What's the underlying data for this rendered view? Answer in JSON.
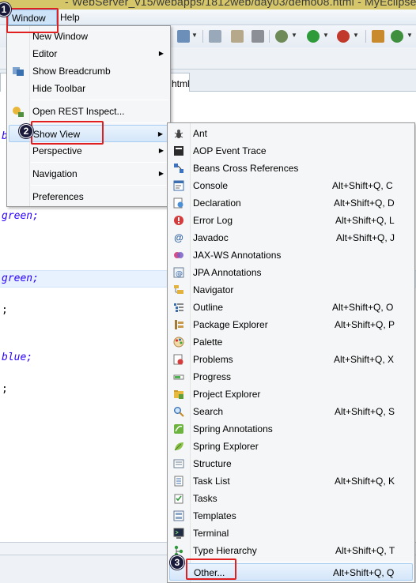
{
  "title_bar": {
    "text": "- WebServer_v15/webapps/1812web/day03/demo08.html - MyEclipse"
  },
  "menubar": {
    "window_label": "Window",
    "help_label": "Help"
  },
  "editor": {
    "tab_label": "html",
    "code_lines": [
      {
        "text": "b",
        "style": "value"
      },
      {
        "text": "green;",
        "style": "value"
      },
      {
        "text": "green;",
        "style": "value"
      },
      {
        "text": ";",
        "style": "plain"
      },
      {
        "text": "blue;",
        "style": "value"
      },
      {
        "text": ";",
        "style": "plain"
      }
    ]
  },
  "window_menu": {
    "items": [
      {
        "label": "New Window",
        "icon": "none"
      },
      {
        "label": "Editor",
        "icon": "none",
        "submenu": true
      },
      {
        "label": "Show Breadcrumb",
        "icon": "breadcrumb-icon"
      },
      {
        "label": "Hide Toolbar",
        "icon": "none"
      },
      {
        "label": "Open REST Inspect...",
        "icon": "rest-inspector-icon"
      },
      {
        "label": "Show View",
        "icon": "none",
        "submenu": true,
        "highlighted": true
      },
      {
        "label": "Perspective",
        "icon": "none",
        "submenu": true
      },
      {
        "label": "Navigation",
        "icon": "none",
        "submenu": true
      },
      {
        "label": "Preferences",
        "icon": "none"
      }
    ]
  },
  "show_view_menu": {
    "items": [
      {
        "label": "Ant",
        "shortcut": "",
        "icon": "ant-icon"
      },
      {
        "label": "AOP Event Trace",
        "shortcut": "",
        "icon": "aop-event-trace-icon"
      },
      {
        "label": "Beans Cross References",
        "shortcut": "",
        "icon": "beans-cross-references-icon"
      },
      {
        "label": "Console",
        "shortcut": "Alt+Shift+Q, C",
        "icon": "console-icon"
      },
      {
        "label": "Declaration",
        "shortcut": "Alt+Shift+Q, D",
        "icon": "declaration-icon"
      },
      {
        "label": "Error Log",
        "shortcut": "Alt+Shift+Q, L",
        "icon": "error-log-icon"
      },
      {
        "label": "Javadoc",
        "shortcut": "Alt+Shift+Q, J",
        "icon": "javadoc-icon"
      },
      {
        "label": "JAX-WS Annotations",
        "shortcut": "",
        "icon": "jax-ws-annotations-icon"
      },
      {
        "label": "JPA Annotations",
        "shortcut": "",
        "icon": "jpa-annotations-icon"
      },
      {
        "label": "Navigator",
        "shortcut": "",
        "icon": "navigator-icon"
      },
      {
        "label": "Outline",
        "shortcut": "Alt+Shift+Q, O",
        "icon": "outline-icon"
      },
      {
        "label": "Package Explorer",
        "shortcut": "Alt+Shift+Q, P",
        "icon": "package-explorer-icon"
      },
      {
        "label": "Palette",
        "shortcut": "",
        "icon": "palette-icon"
      },
      {
        "label": "Problems",
        "shortcut": "Alt+Shift+Q, X",
        "icon": "problems-icon"
      },
      {
        "label": "Progress",
        "shortcut": "",
        "icon": "progress-icon"
      },
      {
        "label": "Project Explorer",
        "shortcut": "",
        "icon": "project-explorer-icon"
      },
      {
        "label": "Search",
        "shortcut": "Alt+Shift+Q, S",
        "icon": "search-icon"
      },
      {
        "label": "Spring Annotations",
        "shortcut": "",
        "icon": "spring-annotations-icon"
      },
      {
        "label": "Spring Explorer",
        "shortcut": "",
        "icon": "spring-explorer-icon"
      },
      {
        "label": "Structure",
        "shortcut": "",
        "icon": "structure-icon"
      },
      {
        "label": "Task List",
        "shortcut": "Alt+Shift+Q, K",
        "icon": "task-list-icon"
      },
      {
        "label": "Tasks",
        "shortcut": "",
        "icon": "tasks-icon"
      },
      {
        "label": "Templates",
        "shortcut": "",
        "icon": "templates-icon"
      },
      {
        "label": "Terminal",
        "shortcut": "",
        "icon": "terminal-icon"
      },
      {
        "label": "Type Hierarchy",
        "shortcut": "Alt+Shift+Q, T",
        "icon": "type-hierarchy-icon"
      },
      {
        "label": "Other...",
        "shortcut": "Alt+Shift+Q, Q",
        "icon": "none",
        "highlighted": true
      }
    ]
  },
  "annotations": {
    "step1": "1",
    "step2": "2",
    "step3": "3"
  },
  "colors": {
    "menu_highlight": "#d4e6f9",
    "annotation_red": "#e02020",
    "code_value_blue": "#2a00ff",
    "title_bar": "#d6c66a"
  }
}
